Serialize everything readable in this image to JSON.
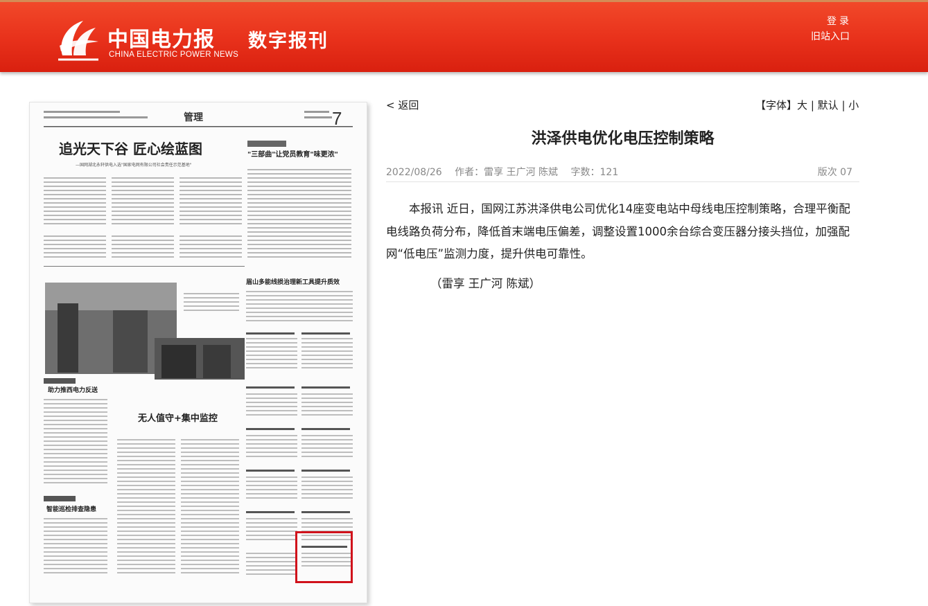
{
  "header": {
    "brand_cn": "中国电力报",
    "brand_en": "CHINA ELECTRIC POWER NEWS",
    "section": "数字报刊",
    "login": "登录",
    "old_site": "旧站入口",
    "colors": {
      "bar": "#e8311b",
      "text": "#ffffff"
    }
  },
  "paper": {
    "page_title": "管理",
    "page_number": "7",
    "headline_main": "追光天下谷 匠心绘蓝图",
    "headline_sub": "—国网湖北永轩供电入选\"国家电网有限公司社会责任示范基地\"",
    "headline_right": "\"三部曲\"让党员教育\"味更浓\"",
    "headline_mid": "无人值守+集中监控",
    "headline_right2": "眉山多能线损治理新工具提升质效",
    "col_left_1": "助力推西电力反送",
    "col_left_2": "智能巡检排查隐患",
    "highlight_color": "#d0121b"
  },
  "article": {
    "back": "< 返回",
    "font_label": "【字体】",
    "font_large": "大",
    "font_default": "默认",
    "font_small": "小",
    "font_sep": "|",
    "title": "洪泽供电优化电压控制策略",
    "date": "2022/08/26",
    "author_label": "作者：",
    "authors": "雷享 王广河 陈斌",
    "count_label": "字数：",
    "count": "121",
    "edition": "版次 07",
    "body": "本报讯 近日，国网江苏洪泽供电公司优化14座变电站中母线电压控制策略，合理平衡配电线路负荷分布，降低首末端电压偏差，调整设置1000余台综合变压器分接头挡位，加强配网“低电压”监测力度，提升供电可靠性。",
    "byline": "（雷享 王广河 陈斌）"
  }
}
